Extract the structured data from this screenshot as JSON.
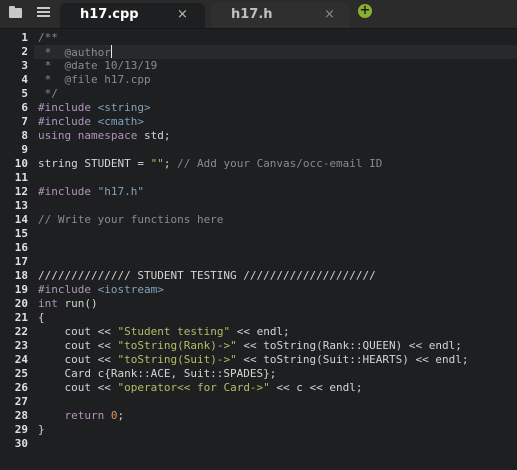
{
  "toolbar": {
    "icons": [
      "folder-icon",
      "file-list-icon"
    ]
  },
  "tabs": [
    {
      "label": "h17.cpp",
      "active": true,
      "close_glyph": "×"
    },
    {
      "label": "h17.h",
      "active": false,
      "close_glyph": "×"
    }
  ],
  "add_tab": {
    "glyph": "+",
    "color": "#8ab12c"
  },
  "editor": {
    "active_line": 2,
    "line_numbers": [
      "1",
      "2",
      "3",
      "4",
      "5",
      "6",
      "7",
      "8",
      "9",
      "10",
      "11",
      "12",
      "13",
      "14",
      "15",
      "16",
      "17",
      "18",
      "19",
      "20",
      "21",
      "22",
      "23",
      "24",
      "25",
      "26",
      "27",
      "28",
      "29",
      "30"
    ],
    "lines": [
      [
        {
          "t": "/**",
          "c": "cm"
        }
      ],
      [
        {
          "t": " *  @author",
          "c": "cm"
        }
      ],
      [
        {
          "t": " *  @date 10/13/19",
          "c": "cm"
        }
      ],
      [
        {
          "t": " *  @file h17.cpp",
          "c": "cm"
        }
      ],
      [
        {
          "t": " */",
          "c": "cm"
        }
      ],
      [
        {
          "t": "#include ",
          "c": "pp"
        },
        {
          "t": "<string>",
          "c": "hdr"
        }
      ],
      [
        {
          "t": "#include ",
          "c": "pp"
        },
        {
          "t": "<cmath>",
          "c": "hdr"
        }
      ],
      [
        {
          "t": "using namespace ",
          "c": "kw"
        },
        {
          "t": "std;",
          "c": "tx"
        }
      ],
      [],
      [
        {
          "t": "string STUDENT = ",
          "c": "tx"
        },
        {
          "t": "\"\"",
          "c": "str"
        },
        {
          "t": "; ",
          "c": "tx"
        },
        {
          "t": "// Add your Canvas/occ-email ID",
          "c": "cm"
        }
      ],
      [],
      [
        {
          "t": "#include ",
          "c": "pp"
        },
        {
          "t": "\"h17.h\"",
          "c": "hdr"
        }
      ],
      [],
      [
        {
          "t": "// Write your functions here",
          "c": "cm"
        }
      ],
      [],
      [],
      [],
      [
        {
          "t": "////////////// STUDENT TESTING ////////////////////",
          "c": "tx"
        }
      ],
      [
        {
          "t": "#include ",
          "c": "pp"
        },
        {
          "t": "<iostream>",
          "c": "hdr"
        }
      ],
      [
        {
          "t": "int ",
          "c": "kw"
        },
        {
          "t": "run()",
          "c": "tx"
        }
      ],
      [
        {
          "t": "{",
          "c": "tx"
        }
      ],
      [
        {
          "t": "    cout << ",
          "c": "tx"
        },
        {
          "t": "\"Student testing\"",
          "c": "str"
        },
        {
          "t": " << endl;",
          "c": "tx"
        }
      ],
      [
        {
          "t": "    cout << ",
          "c": "tx"
        },
        {
          "t": "\"toString(Rank)->\"",
          "c": "str"
        },
        {
          "t": " << toString(Rank::QUEEN) << endl;",
          "c": "tx"
        }
      ],
      [
        {
          "t": "    cout << ",
          "c": "tx"
        },
        {
          "t": "\"toString(Suit)->\"",
          "c": "str"
        },
        {
          "t": " << toString(Suit::HEARTS) << endl;",
          "c": "tx"
        }
      ],
      [
        {
          "t": "    Card c{Rank::ACE, Suit::SPADES};",
          "c": "tx"
        }
      ],
      [
        {
          "t": "    cout << ",
          "c": "tx"
        },
        {
          "t": "\"operator<< for Card->\"",
          "c": "str"
        },
        {
          "t": " << c << endl;",
          "c": "tx"
        }
      ],
      [],
      [
        {
          "t": "    return ",
          "c": "kw"
        },
        {
          "t": "0",
          "c": "num"
        },
        {
          "t": ";",
          "c": "tx"
        }
      ],
      [
        {
          "t": "}",
          "c": "tx"
        }
      ],
      []
    ]
  }
}
